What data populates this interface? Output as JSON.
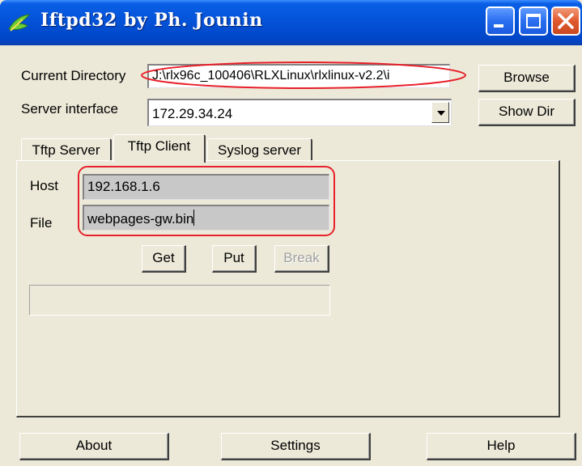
{
  "window": {
    "title": "Iftpd32 by Ph. Jounin"
  },
  "current_directory": {
    "label": "Current Directory",
    "value": "J:\\rlx96c_100406\\RLXLinux\\rlxlinux-v2.2\\i"
  },
  "server_interface": {
    "label": "Server interface",
    "value": "172.29.34.24"
  },
  "buttons": {
    "browse": "Browse",
    "show_dir": "Show Dir",
    "get": "Get",
    "put": "Put",
    "break": "Break",
    "about": "About",
    "settings": "Settings",
    "help": "Help"
  },
  "tabs": [
    {
      "label": "Tftp Server",
      "active": false
    },
    {
      "label": "Tftp Client",
      "active": true
    },
    {
      "label": "Syslog server",
      "active": false
    }
  ],
  "tftp_client": {
    "host_label": "Host",
    "host_value": "192.168.1.6",
    "file_label": "File",
    "file_value": "webpages-gw.bin"
  },
  "annotations": {
    "highlight_color": "#e8202a"
  },
  "colors": {
    "title_bar": "#0453d8",
    "window_bg": "#ece9d8",
    "close_button": "#e0592e"
  }
}
